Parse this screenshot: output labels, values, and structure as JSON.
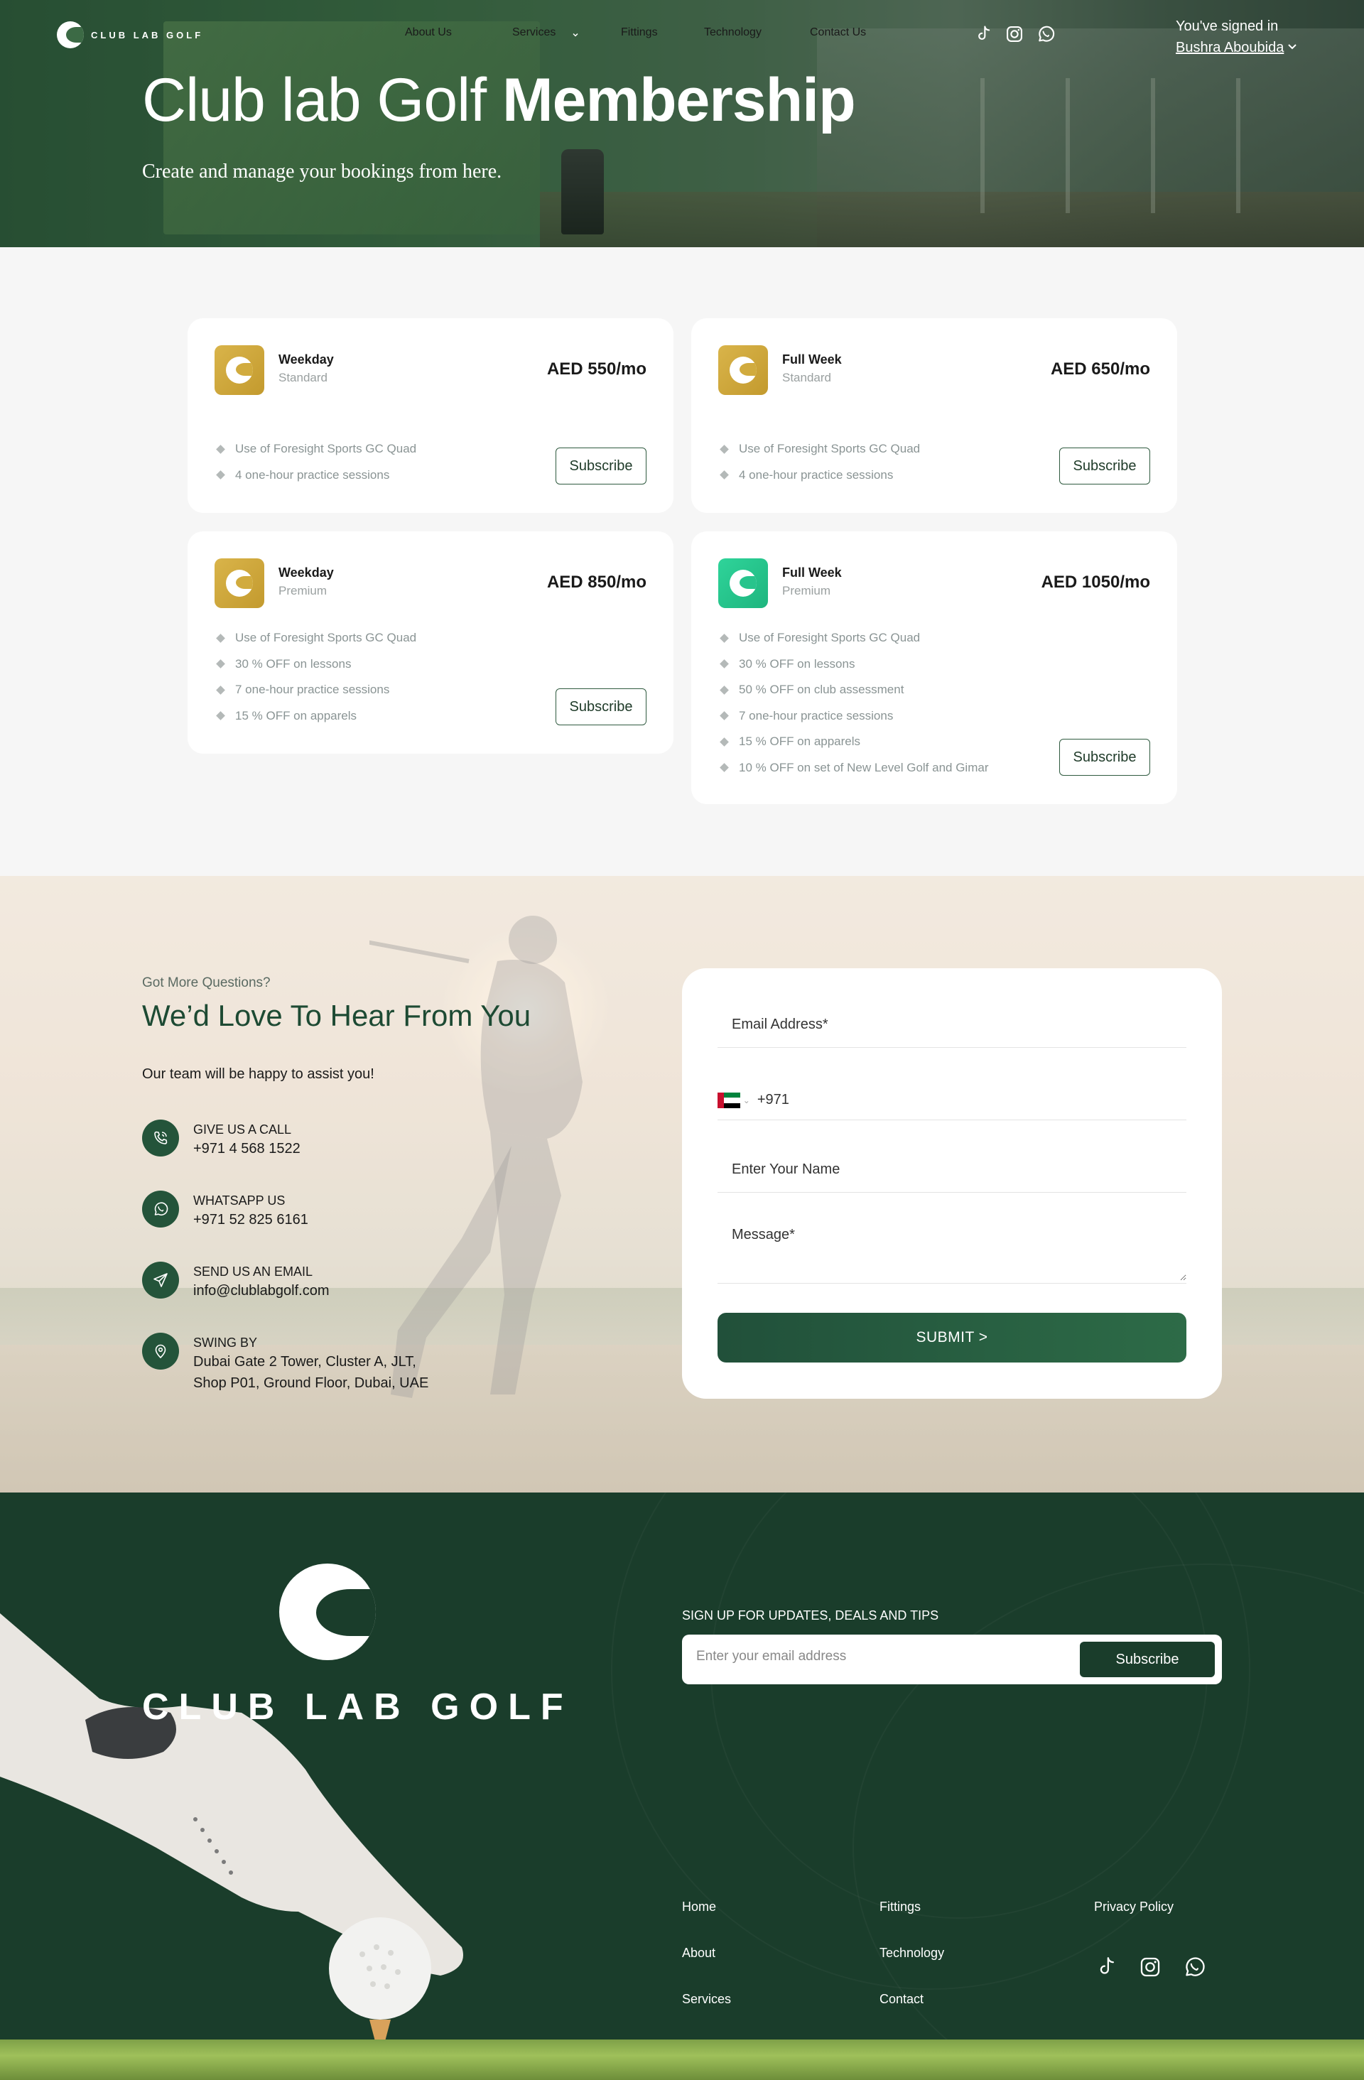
{
  "nav": {
    "logo_text": "CLUB LAB GOLF",
    "links": [
      "About Us",
      "Services",
      "Fittings",
      "Technology",
      "Contact Us"
    ],
    "services_chevron": "chevron-down-icon",
    "social_icons": [
      "tiktok-icon",
      "instagram-icon",
      "whatsapp-icon"
    ],
    "signed_in_label": "You've signed in",
    "user_name": "Bushra Aboubida"
  },
  "hero": {
    "title_light": "Club lab Golf ",
    "title_bold": "Membership",
    "subtitle": "Create and manage your bookings from here."
  },
  "plans": [
    {
      "name": "Weekday",
      "tier": "Standard",
      "price": "AED 550/mo",
      "icon_color": "gold",
      "features": [
        "Use of Foresight Sports GC Quad",
        "4 one-hour practice sessions"
      ],
      "button": "Subscribe"
    },
    {
      "name": "Full Week",
      "tier": "Standard",
      "price": "AED 650/mo",
      "icon_color": "gold",
      "features": [
        "Use of Foresight Sports GC Quad",
        "4 one-hour practice sessions"
      ],
      "button": "Subscribe"
    },
    {
      "name": "Weekday",
      "tier": "Premium",
      "price": "AED 850/mo",
      "icon_color": "gold",
      "features": [
        "Use of Foresight Sports GC Quad",
        "30 % OFF on lessons",
        "7 one-hour practice sessions",
        "15 % OFF on apparels"
      ],
      "button": "Subscribe"
    },
    {
      "name": "Full Week",
      "tier": "Premium",
      "price": "AED 1050/mo",
      "icon_color": "green",
      "features": [
        "Use of Foresight Sports GC Quad",
        "30 % OFF on lessons",
        "50 % OFF on club assessment",
        "7 one-hour practice sessions",
        "15 % OFF on apparels",
        "10 % OFF on set of New Level Golf and Gimar"
      ],
      "button": "Subscribe"
    }
  ],
  "contact": {
    "eyebrow": "Got More Questions?",
    "title": "We’d Love To Hear From You",
    "lead": "Our team will be happy to assist you!",
    "items": [
      {
        "label": "GIVE US A CALL",
        "value": "+971 4 568 1522",
        "icon": "phone-icon"
      },
      {
        "label": "WHATSAPP US",
        "value": "+971 52 825 6161",
        "icon": "whatsapp-icon"
      },
      {
        "label": "SEND US AN EMAIL",
        "value": "info@clublabgolf.com",
        "icon": "send-icon"
      },
      {
        "label": "SWING BY",
        "value": "Dubai Gate 2 Tower, Cluster A, JLT,",
        "value2": "Shop P01, Ground Floor, Dubai, UAE",
        "icon": "location-pin-icon"
      }
    ],
    "form": {
      "email_placeholder": "Email Address*",
      "phone_code": "+971",
      "name_placeholder": "Enter Your Name",
      "message_placeholder": "Message*",
      "submit_label": "SUBMIT   >"
    }
  },
  "footer": {
    "logo_text": "CLUB LAB GOLF",
    "signup_label": "SIGN UP FOR UPDATES, DEALS AND TIPS",
    "signup_placeholder": "Enter your email address",
    "signup_button": "Subscribe",
    "links_col1": [
      "Home",
      "About",
      "Services"
    ],
    "links_col2": [
      "Fittings",
      "Technology",
      "Contact"
    ],
    "privacy": "Privacy Policy",
    "social_icons": [
      "tiktok-icon",
      "instagram-icon",
      "whatsapp-icon"
    ]
  },
  "colors": {
    "brand_dark": "#1a3d2b",
    "brand_green": "#24543a",
    "gold": "#d1ab3e",
    "premium_green": "#27c48c"
  }
}
